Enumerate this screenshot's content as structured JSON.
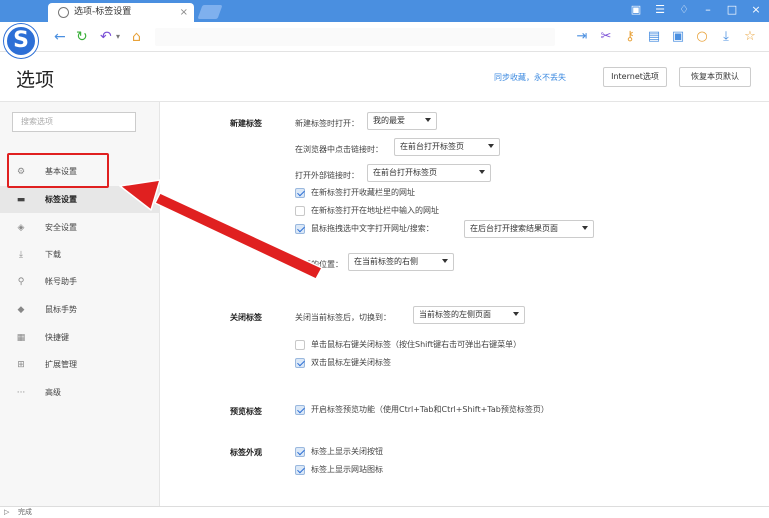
{
  "browser": {
    "tab_title": "选项-标签设置",
    "tab_close": "×",
    "logo_letter": "S",
    "status_text": "完成",
    "accent": "#4a8fe0"
  },
  "header": {
    "title": "选项",
    "sync_link": "同步收藏，永不丢失",
    "internet_options": "Internet选项",
    "restore_defaults": "恢复本页默认"
  },
  "sidebar": {
    "search_placeholder": "搜索选项",
    "items": [
      {
        "label": "基本设置",
        "icon": "gear-icon"
      },
      {
        "label": "标签设置",
        "icon": "tab-icon"
      },
      {
        "label": "安全设置",
        "icon": "shield-icon"
      },
      {
        "label": "下载",
        "icon": "download-icon"
      },
      {
        "label": "帐号助手",
        "icon": "key-icon"
      },
      {
        "label": "鼠标手势",
        "icon": "mouse-icon"
      },
      {
        "label": "快捷键",
        "icon": "keyboard-icon"
      },
      {
        "label": "扩展管理",
        "icon": "grid-icon"
      },
      {
        "label": "高级",
        "icon": "more-icon"
      }
    ],
    "highlight_color": "#e02020"
  },
  "new_tab": {
    "title": "新建标签",
    "open_label": "新建标签时打开：",
    "open_value": "我的最爱",
    "browser_link_label": "在浏览器中点击链接时：",
    "browser_link_value": "在前台打开标签页",
    "external_link_label": "打开外部链接时：",
    "external_link_value": "在前台打开标签页",
    "cb1": "在新标签打开收藏栏里的网址",
    "cb2": "在新标签打开在地址栏中输入的网址",
    "cb3": "鼠标拖拽选中文字打开网址/搜索：",
    "cb3_value": "在后台打开搜索结果页面",
    "position_label": "打开的位置：",
    "position_value": "在当前标签的右侧"
  },
  "close_tab": {
    "title": "关闭标签",
    "switch_label": "关闭当前标签后，切换到：",
    "switch_value": "当前标签的左侧页面",
    "cb1": "单击鼠标右键关闭标签（按住Shift键右击可弹出右键菜单）",
    "cb2": "双击鼠标左键关闭标签"
  },
  "preview_tab": {
    "title": "预览标签",
    "cb1": "开启标签预览功能（使用Ctrl+Tab和Ctrl+Shift+Tab预览标签页）"
  },
  "tab_appearance": {
    "title": "标签外观",
    "cb1": "标签上显示关闭按钮",
    "cb2": "标签上显示网站图标"
  }
}
